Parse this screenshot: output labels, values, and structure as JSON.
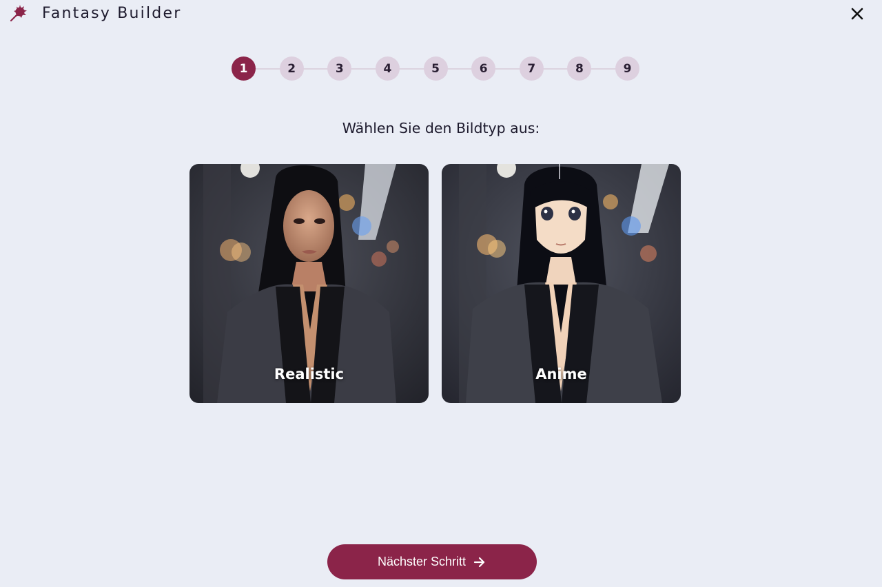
{
  "header": {
    "title": "Fantasy Builder",
    "logo_icon": "wand-sparkle-icon",
    "close_icon": "close-icon"
  },
  "stepper": {
    "current": 1,
    "steps": [
      "1",
      "2",
      "3",
      "4",
      "5",
      "6",
      "7",
      "8",
      "9"
    ]
  },
  "question": "Wählen Sie den Bildtyp aus:",
  "options": [
    {
      "label": "Realistic",
      "selected": false
    },
    {
      "label": "Anime",
      "selected": false
    }
  ],
  "next_button": {
    "label": "Nächster Schritt",
    "icon": "arrow-right-icon"
  },
  "colors": {
    "background": "#eaedf5",
    "accent": "#8b2449",
    "step_inactive": "#ddd0df",
    "text": "#1e1b2e"
  }
}
